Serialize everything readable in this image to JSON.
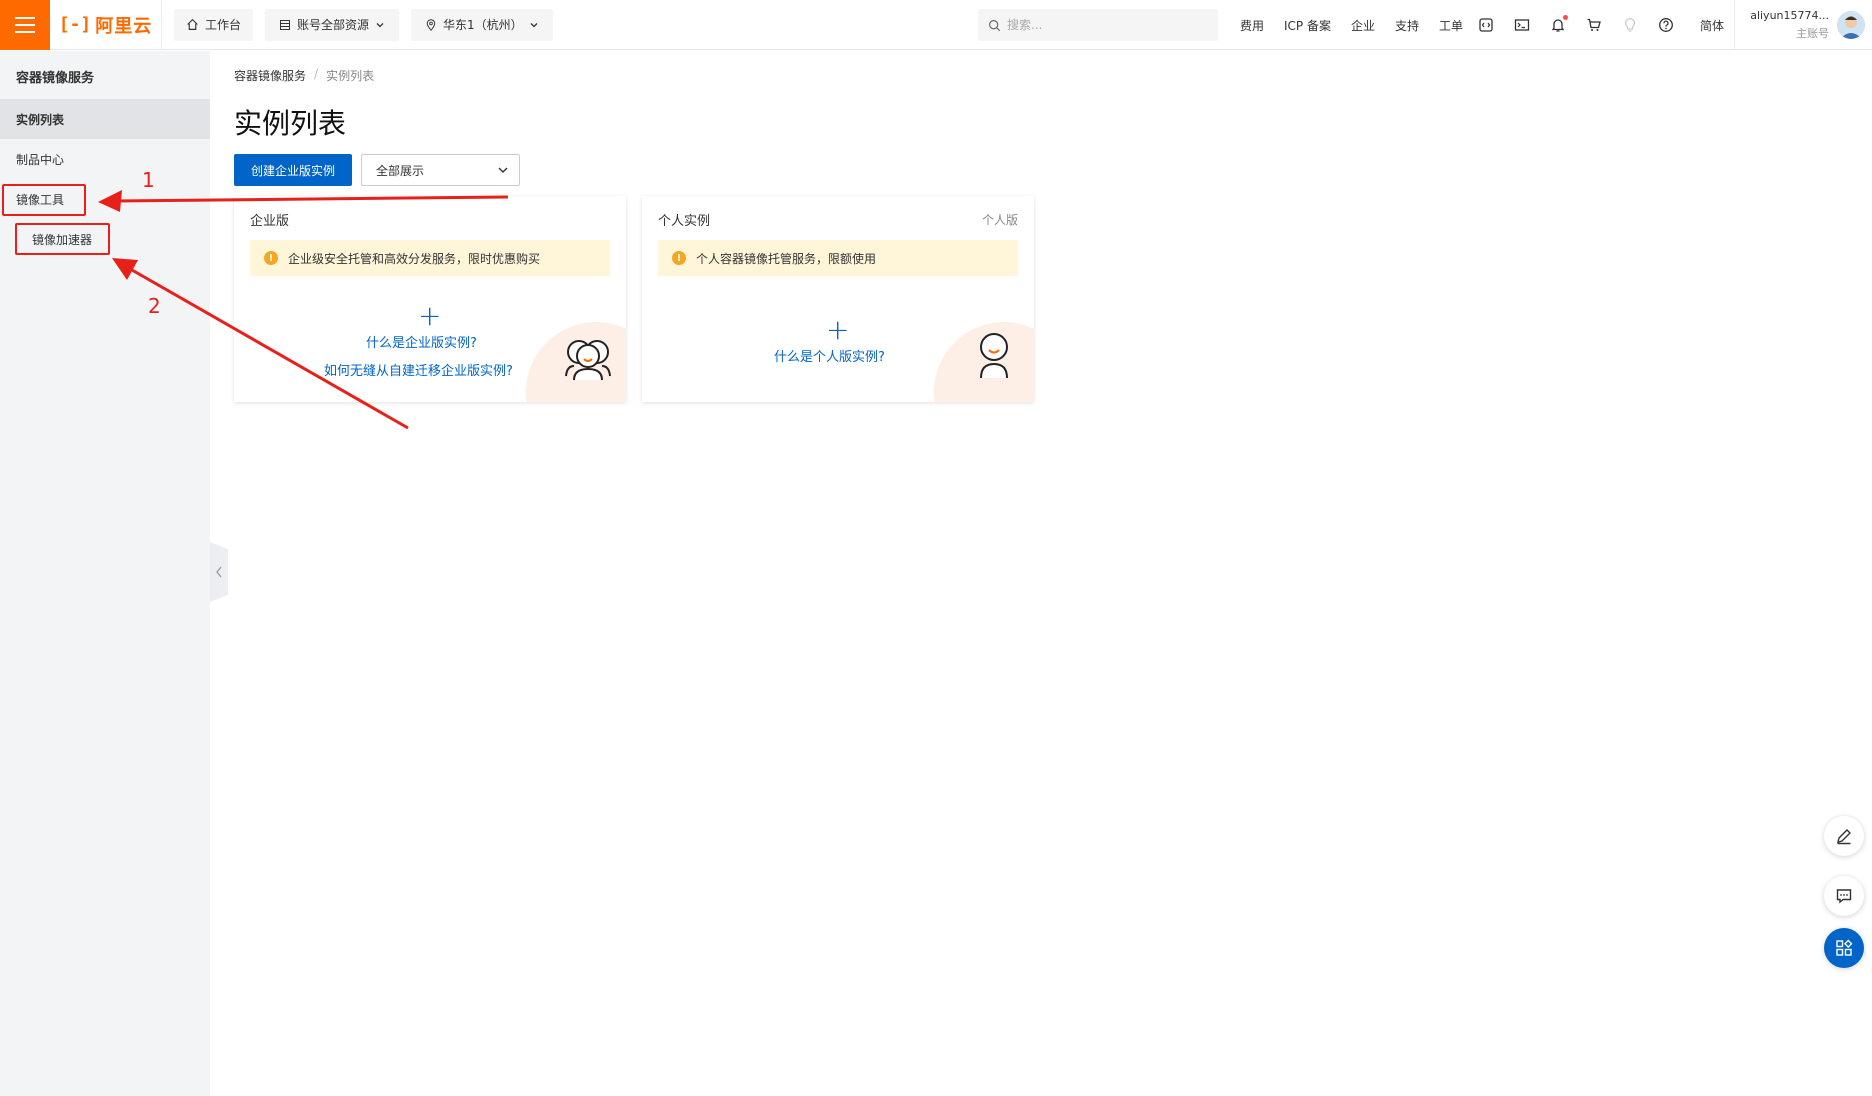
{
  "topbar": {
    "logo_text": "阿里云",
    "workbench_label": "工作台",
    "resource_label": "账号全部资源",
    "region_label": "华东1（杭州）",
    "search_placeholder": "搜索...",
    "links": [
      "费用",
      "ICP 备案",
      "企业",
      "支持",
      "工单"
    ],
    "lang": "简体",
    "username": "aliyun15774...",
    "account_role": "主账号",
    "icons": [
      "code-icon",
      "terminal-icon",
      "bell-icon",
      "cart-icon",
      "lightbulb-icon",
      "help-icon"
    ]
  },
  "sidebar": {
    "title": "容器镜像服务",
    "items": [
      {
        "label": "实例列表",
        "active": true
      },
      {
        "label": "制品中心"
      },
      {
        "label": "镜像工具"
      },
      {
        "label": "镜像加速器",
        "sub": true
      }
    ]
  },
  "breadcrumb": [
    "容器镜像服务",
    "实例列表"
  ],
  "page": {
    "title": "实例列表",
    "create_button": "创建企业版实例",
    "filter_select": "全部展示"
  },
  "cards": [
    {
      "title": "企业版",
      "tag": "",
      "notice": "企业级安全托管和高效分发服务，限时优惠购买",
      "links": [
        "什么是企业版实例?",
        "如何无缝从自建迁移企业版实例?"
      ]
    },
    {
      "title": "个人实例",
      "tag": "个人版",
      "notice": "个人容器镜像托管服务，限额使用",
      "links": [
        "什么是个人版实例?"
      ]
    }
  ],
  "annotations": {
    "label_1": "1",
    "label_2": "2",
    "color": "#e8201a"
  },
  "colors": {
    "brand": "#ff6a00",
    "primary": "#0064c8"
  }
}
